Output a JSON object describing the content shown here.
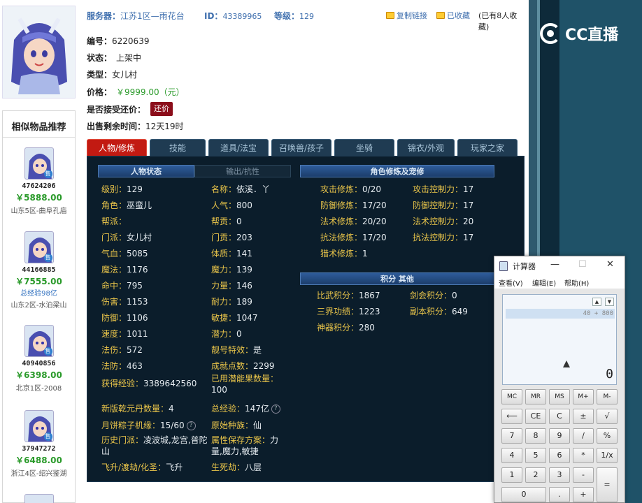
{
  "header": {
    "server_label": "服务器：",
    "server_value": "江苏1区—雨花台",
    "id_label": "ID：",
    "id_value": "43389965",
    "level_label": "等级：",
    "level_value": "129",
    "copy_link": "复制链接",
    "favorited": "已收藏",
    "fav_count": "(已有8人收藏)"
  },
  "logo": {
    "text": "CC直播"
  },
  "info": {
    "number_label": "编号：",
    "number_value": "6220639",
    "status_label": "状态：",
    "status_value": "上架中",
    "type_label": "类型：",
    "type_value": "女儿村",
    "price_label": "价格：",
    "price_value": "￥9999.00（元）",
    "counter_label": "是否接受还价：",
    "counter_button": "还价",
    "time_label": "出售剩余时间：",
    "time_value": "12天19时"
  },
  "similar": {
    "title": "相似物品推荐",
    "sell_badge": "售",
    "items": [
      {
        "id": "47624206",
        "price": "￥5888.00",
        "extra": "",
        "server": "山东5区-曲阜孔庙"
      },
      {
        "id": "44166885",
        "price": "￥7555.00",
        "extra": "总经验98亿",
        "server": "山东2区-水泊梁山"
      },
      {
        "id": "40940856",
        "price": "￥6398.00",
        "extra": "",
        "server": "北京1区-2008"
      },
      {
        "id": "37947272",
        "price": "￥6488.00",
        "extra": "",
        "server": "浙江4区-绍兴鉴湖"
      }
    ]
  },
  "tabs": [
    "人物/修炼",
    "技能",
    "道具/法宝",
    "召唤兽/孩子",
    "坐骑",
    "锦衣/外观",
    "玩家之家"
  ],
  "panel": {
    "section_status": "人物状态",
    "section_output": "输出/抗性",
    "section_cultivation": "角色修炼及宠修",
    "section_points": "积分 其他",
    "left_stats": [
      {
        "label": "级别：",
        "value": "129"
      },
      {
        "label": "角色：",
        "value": "巫蛮儿"
      },
      {
        "label": "帮派：",
        "value": ""
      },
      {
        "label": "门派：",
        "value": "女儿村"
      },
      {
        "label": "气血：",
        "value": "5085"
      },
      {
        "label": "魔法：",
        "value": "1176"
      },
      {
        "label": "命中：",
        "value": "795"
      },
      {
        "label": "伤害：",
        "value": "1153"
      },
      {
        "label": "防御：",
        "value": "1106"
      },
      {
        "label": "速度：",
        "value": "1011"
      },
      {
        "label": "法伤：",
        "value": "572"
      },
      {
        "label": "法防：",
        "value": "463"
      }
    ],
    "mid_stats": [
      {
        "label": "名称：",
        "value": "依溪．丫"
      },
      {
        "label": "人气：",
        "value": "800"
      },
      {
        "label": "帮贡：",
        "value": "0"
      },
      {
        "label": "门贡：",
        "value": "203"
      },
      {
        "label": "体质：",
        "value": "141"
      },
      {
        "label": "魔力：",
        "value": "139"
      },
      {
        "label": "力量：",
        "value": "146"
      },
      {
        "label": "耐力：",
        "value": "189"
      },
      {
        "label": "敏捷：",
        "value": "1047"
      },
      {
        "label": "潜力：",
        "value": "0"
      },
      {
        "label": "靓号特效：",
        "value": "是"
      },
      {
        "label": "成就点数：",
        "value": "2299"
      }
    ],
    "exp_label": "获得经验：",
    "exp_value": "3389642560",
    "fruit_label": "已用潜能果数量：",
    "fruit_value": "100",
    "pill_label": "新版乾元丹数量：",
    "pill_value": "4",
    "total_exp_label": "总经验：",
    "total_exp_value": "147亿",
    "help_mark": "?",
    "zongzi_label": "月饼粽子机缘：",
    "zongzi_value": "15/60",
    "race_label": "原始种族：",
    "race_value": "仙",
    "history_label": "历史门派：",
    "history_value": "凌波城,龙宫,普陀山",
    "plan_label": "属性保存方案：",
    "plan_value": "力量,魔力,敏捷",
    "ascend_label": "飞升/渡劫/化圣：",
    "ascend_value": "飞升",
    "life_label": "生死劫：",
    "life_value": "八层",
    "cultivation": [
      {
        "label": "攻击修炼：",
        "value": "0/20",
        "label2": "攻击控制力：",
        "value2": "17"
      },
      {
        "label": "防御修炼：",
        "value": "17/20",
        "label2": "防御控制力：",
        "value2": "17"
      },
      {
        "label": "法术修炼：",
        "value": "20/20",
        "label2": "法术控制力：",
        "value2": "20"
      },
      {
        "label": "抗法修炼：",
        "value": "17/20",
        "label2": "抗法控制力：",
        "value2": "17"
      },
      {
        "label": "猎术修炼：",
        "value": "1",
        "label2": "",
        "value2": ""
      }
    ],
    "points": [
      {
        "label": "比武积分：",
        "value": "1867",
        "label2": "剑会积分：",
        "value2": "0"
      },
      {
        "label": "三界功绩：",
        "value": "1223",
        "label2": "副本积分：",
        "value2": "649"
      },
      {
        "label": "神器积分：",
        "value": "280",
        "label2": "",
        "value2": ""
      }
    ]
  },
  "calculator": {
    "title": "计算器",
    "minimize": "—",
    "maximize": "☐",
    "close": "✕",
    "menu": [
      "查看(V)",
      "编辑(E)",
      "帮助(H)"
    ],
    "history": "40 + 800",
    "display": "0",
    "up": "▲",
    "down": "▼",
    "keys": [
      [
        "MC",
        "MR",
        "MS",
        "M+",
        "M-"
      ],
      [
        "⟵",
        "CE",
        "C",
        "±",
        "√"
      ],
      [
        "7",
        "8",
        "9",
        "/",
        "%"
      ],
      [
        "4",
        "5",
        "6",
        "*",
        "1/x"
      ],
      [
        "1",
        "2",
        "3",
        "-",
        "="
      ],
      [
        "0",
        ".",
        "+"
      ]
    ]
  }
}
